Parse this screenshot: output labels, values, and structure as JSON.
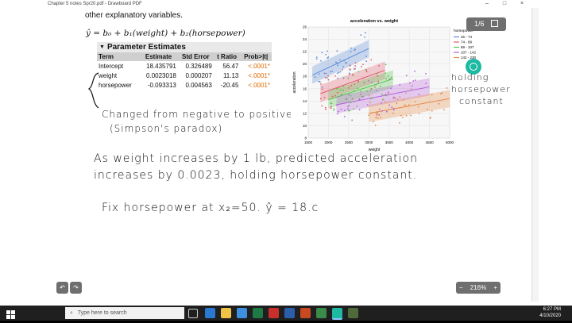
{
  "window": {
    "title": "Chapter 5 notes Spr20.pdf - Drawboard PDF",
    "buttons": [
      "–",
      "□",
      "×"
    ]
  },
  "document": {
    "intro_text": "other explanatory variables.",
    "equation": "ŷ = b₀ + b₁(weight) + b₂(horsepower)",
    "table": {
      "title": "Parameter Estimates",
      "columns": [
        "Term",
        "Estimate",
        "Std Error",
        "t Ratio",
        "Prob>|t|"
      ],
      "rows": [
        [
          "Intercept",
          "18.435791",
          "0.326489",
          "56.47",
          "<.0001*"
        ],
        [
          "weight",
          "0.0023018",
          "0.000207",
          "11.13",
          "<.0001*"
        ],
        [
          "horsepower",
          "-0.093313",
          "0.004563",
          "-20.45",
          "<.0001*"
        ]
      ]
    },
    "note1_line1": "Changed from negative to positive",
    "note1_line2": "(Simpson's paradox)",
    "note2_line1": "holding",
    "note2_line2": "horsepower",
    "note2_line3": "constant",
    "statement_line1": "As weight increases by 1 lb, predicted acceleration",
    "statement_line2": "increases by 0.0023, holding horsepower constant.",
    "statement_line3": "Fix horsepower at x₂=50. ŷ = 18.c"
  },
  "chart_data": {
    "type": "scatter",
    "title": "acceleration vs. weight",
    "xlabel": "weight",
    "ylabel": "acceleration",
    "xlim": [
      1500,
      5000
    ],
    "ylim": [
      8,
      26
    ],
    "xticks": [
      1500,
      2000,
      2500,
      3000,
      3500,
      4000,
      4500,
      5000
    ],
    "yticks": [
      8,
      10,
      12,
      14,
      16,
      18,
      20,
      22,
      24,
      26
    ],
    "grid": true,
    "legend_title": "horsepower",
    "legend_position": "right",
    "series": [
      {
        "name": "46 - 74",
        "color": "#5b8bd8",
        "fit": [
          [
            1600,
            18.2
          ],
          [
            3000,
            22.5
          ]
        ]
      },
      {
        "name": "74 - 89",
        "color": "#e05a6a",
        "fit": [
          [
            1800,
            15.2
          ],
          [
            3400,
            19.0
          ]
        ]
      },
      {
        "name": "89 - 107",
        "color": "#55c24a",
        "fit": [
          [
            2000,
            14.2
          ],
          [
            3600,
            17.6
          ]
        ]
      },
      {
        "name": "107 - 142",
        "color": "#b561d8",
        "fit": [
          [
            2200,
            13.4
          ],
          [
            4500,
            16.3
          ]
        ]
      },
      {
        "name": "142 - 230",
        "color": "#e58a4a",
        "fit": [
          [
            3000,
            12.0
          ],
          [
            5000,
            14.4
          ]
        ]
      }
    ]
  },
  "pager": {
    "label": "1/6"
  },
  "zoom": {
    "value": "216%",
    "minus": "−",
    "plus": "+"
  },
  "taskbar": {
    "search_placeholder": "Type here to search",
    "time": "6:27 PM",
    "date": "4/10/2020"
  }
}
